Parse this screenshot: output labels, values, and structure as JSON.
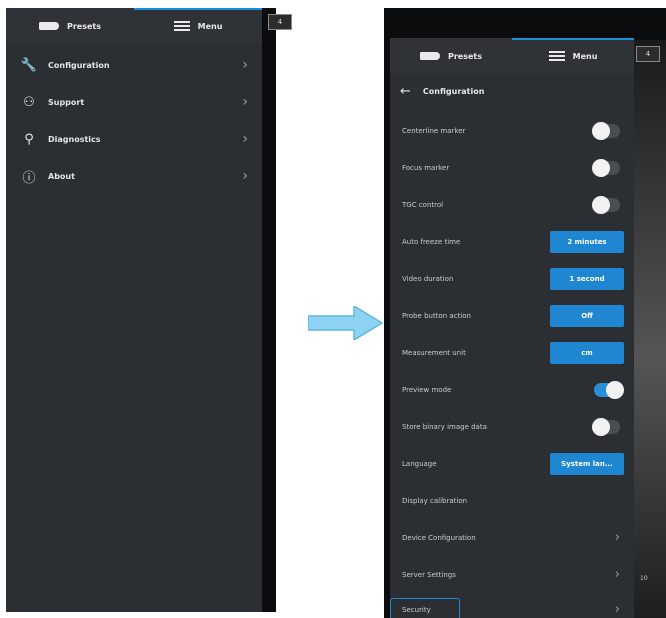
{
  "tabs": {
    "presets": "Presets",
    "menu": "Menu"
  },
  "left_menu": [
    {
      "label": "Configuration",
      "icon": "wrench-icon",
      "glyph": "🔧"
    },
    {
      "label": "Support",
      "icon": "support-icon",
      "glyph": "⚇"
    },
    {
      "label": "Diagnostics",
      "icon": "diagnostics-icon",
      "glyph": "⚲"
    },
    {
      "label": "About",
      "icon": "info-icon",
      "glyph": "ⓘ"
    }
  ],
  "config_header": {
    "back": "←",
    "title": "Configuration"
  },
  "settings": [
    {
      "label": "Centerline marker",
      "kind": "toggle",
      "state": "off"
    },
    {
      "label": "Focus marker",
      "kind": "toggle",
      "state": "off"
    },
    {
      "label": "TGC control",
      "kind": "toggle",
      "state": "off"
    },
    {
      "label": "Auto freeze time",
      "kind": "value",
      "value": "2 minutes"
    },
    {
      "label": "Video duration",
      "kind": "value",
      "value": "1 second"
    },
    {
      "label": "Probe button action",
      "kind": "value",
      "value": "Off"
    },
    {
      "label": "Measurement unit",
      "kind": "value",
      "value": "cm"
    },
    {
      "label": "Preview mode",
      "kind": "toggle",
      "state": "on"
    },
    {
      "label": "Store binary image data",
      "kind": "toggle",
      "state": "off"
    },
    {
      "label": "Language",
      "kind": "value",
      "value": "System lan..."
    },
    {
      "label": "Display calibration",
      "kind": "none"
    },
    {
      "label": "Device Configuration",
      "kind": "chevron"
    },
    {
      "label": "Server Settings",
      "kind": "chevron"
    },
    {
      "label": "Security",
      "kind": "chevron"
    }
  ],
  "camera_badge": "4",
  "image_label": "10",
  "colors": {
    "accent": "#1f86d1",
    "panel": "#2b2e32",
    "arrow": "#7cc8ee"
  }
}
